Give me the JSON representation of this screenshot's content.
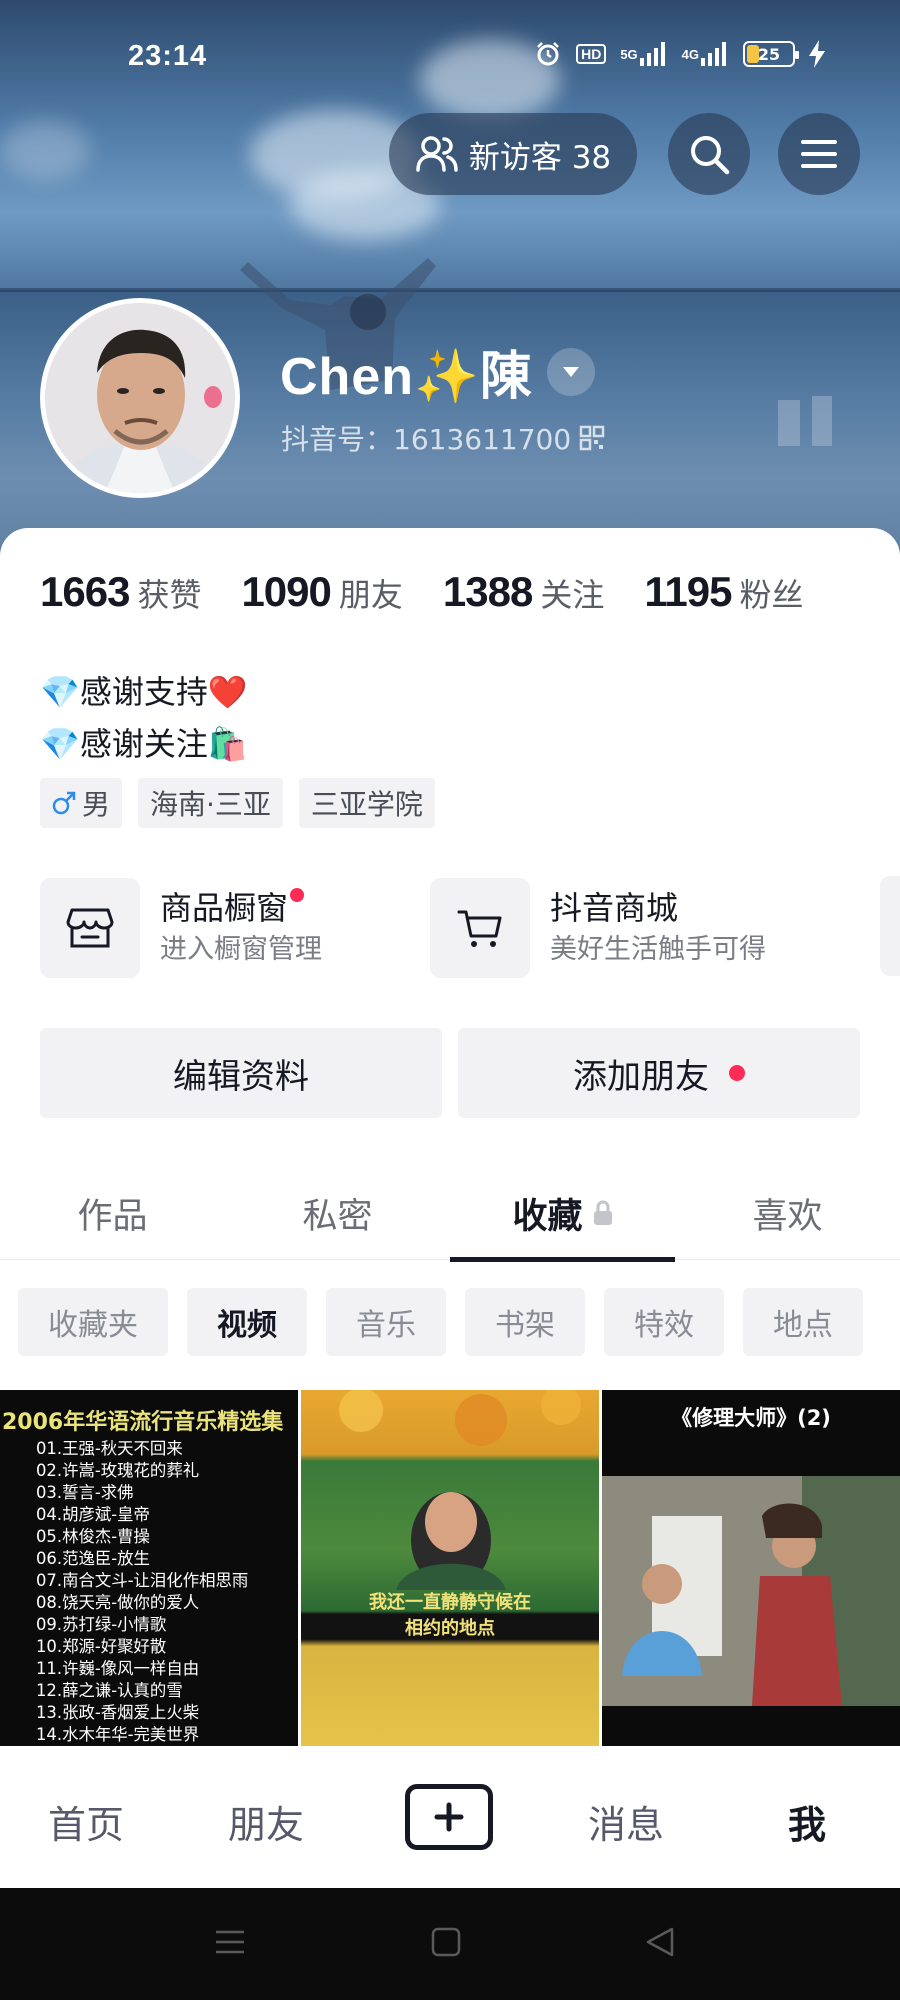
{
  "status_bar": {
    "time": "23:14",
    "hd_label": "HD",
    "net1": "5G",
    "net2": "4G",
    "battery": "25"
  },
  "header": {
    "visitor_label": "新访客 38",
    "search_icon": "search-icon",
    "menu_icon": "menu-icon"
  },
  "profile": {
    "nickname": "Chen✨陳",
    "douyin_id": "抖音号：1613611700"
  },
  "stats": [
    {
      "num": "1663",
      "label": "获赞"
    },
    {
      "num": "1090",
      "label": "朋友"
    },
    {
      "num": "1388",
      "label": "关注"
    },
    {
      "num": "1195",
      "label": "粉丝"
    }
  ],
  "bio": {
    "line1": "💎感谢支持❤️",
    "line2": "💎感谢关注🛍️"
  },
  "tags": {
    "gender": "男",
    "location": "海南·三亚",
    "school": "三亚学院"
  },
  "shop": {
    "window_title": "商品橱窗",
    "window_sub": "进入橱窗管理",
    "mall_title": "抖音商城",
    "mall_sub": "美好生活触手可得"
  },
  "actions": {
    "edit": "编辑资料",
    "add_friend": "添加朋友"
  },
  "tabs": [
    "作品",
    "私密",
    "收藏",
    "喜欢"
  ],
  "chips": [
    "收藏夹",
    "视频",
    "音乐",
    "书架",
    "特效",
    "地点"
  ],
  "videos": {
    "v1_title": "2006年华语流行音乐精选集",
    "v1_list": [
      "01.王强-秋天不回来",
      "02.许嵩-玫瑰花的葬礼",
      "03.誓言-求佛",
      "04.胡彦斌-皇帝",
      "05.林俊杰-曹操",
      "06.范逸臣-放生",
      "07.南合文斗-让泪化作相思雨",
      "08.饶天亮-做你的爱人",
      "09.苏打绿-小情歌",
      "10.郑源-好聚好散",
      "11.许巍-像风一样自由",
      "12.薛之谦-认真的雪",
      "13.张政-香烟爱上火柴",
      "14.水木年华-完美世界"
    ],
    "v2_caption_line1": "我还一直静静守候在",
    "v2_caption_line2": "相约的地点",
    "v3_title": "《修理大师》(2)"
  },
  "bottom_nav": [
    "首页",
    "朋友",
    "消息",
    "我"
  ],
  "colors": {
    "accent_red": "#fe2c55",
    "text_primary": "#161823",
    "chip_bg": "#f2f2f4"
  }
}
